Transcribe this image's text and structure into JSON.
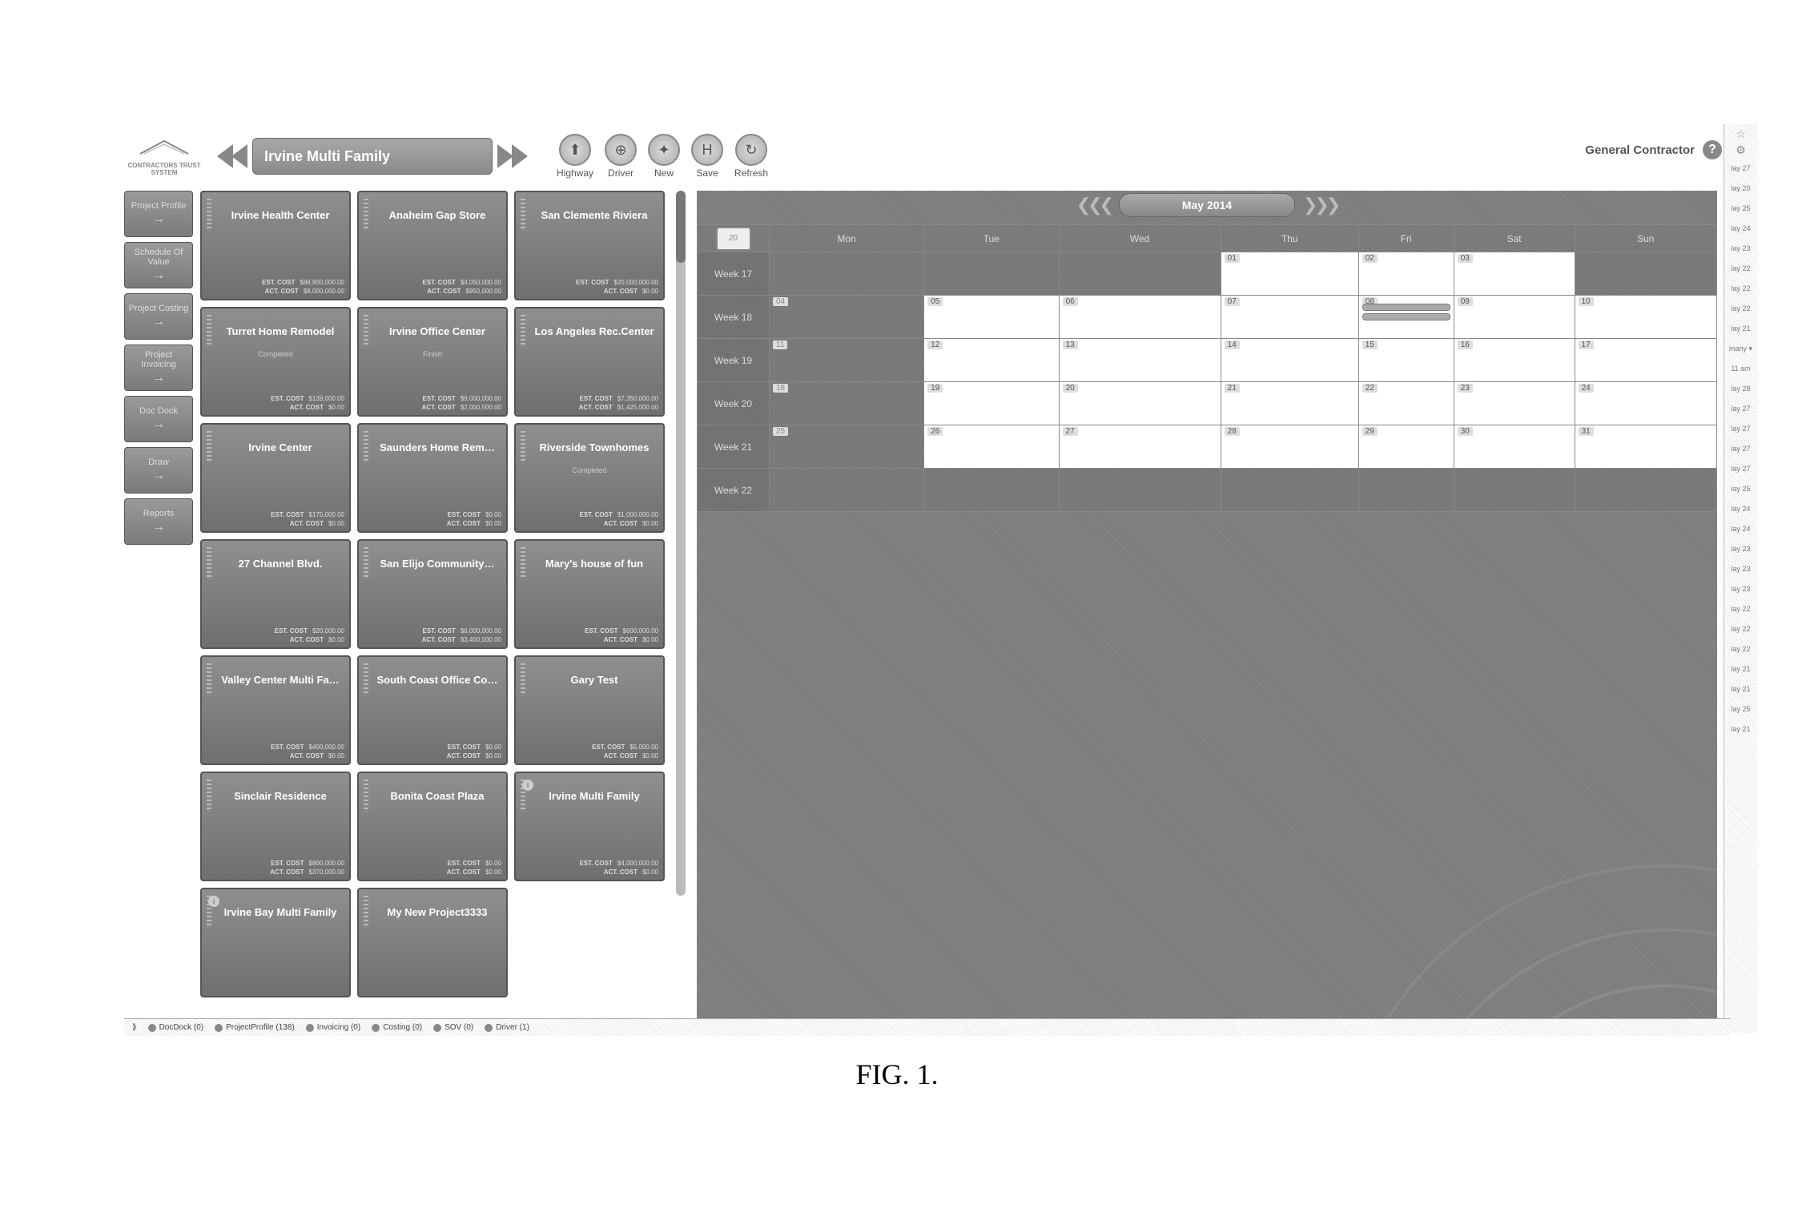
{
  "header": {
    "logo_text": "CONTRACTORS TRUST SYSTEM",
    "project_title": "Irvine Multi Family",
    "user_role": "General Contractor",
    "actions": [
      {
        "id": "highway",
        "label": "Highway",
        "glyph": "⬆"
      },
      {
        "id": "driver",
        "label": "Driver",
        "glyph": "⊕"
      },
      {
        "id": "new",
        "label": "New",
        "glyph": "✦"
      },
      {
        "id": "save",
        "label": "Save",
        "glyph": "H"
      },
      {
        "id": "refresh",
        "label": "Refresh",
        "glyph": "↻"
      }
    ]
  },
  "sidebar": [
    {
      "id": "project-profile",
      "label": "Project Profile"
    },
    {
      "id": "schedule-of-value",
      "label": "Schedule Of Value"
    },
    {
      "id": "project-costing",
      "label": "Project Costing"
    },
    {
      "id": "project-invoicing",
      "label": "Project Invoicing"
    },
    {
      "id": "doc-dock",
      "label": "Doc Dock"
    },
    {
      "id": "draw",
      "label": "Draw"
    },
    {
      "id": "reports",
      "label": "Reports"
    }
  ],
  "projects": [
    {
      "title": "Irvine Health Center",
      "status": "",
      "est": "$88,800,000.00",
      "act": "$8,000,000.00"
    },
    {
      "title": "Anaheim Gap Store",
      "status": "",
      "est": "$4,050,000.00",
      "act": "$950,000.00"
    },
    {
      "title": "San Clemente Riviera",
      "status": "",
      "est": "$20,000,000.00",
      "act": "$0.00"
    },
    {
      "title": "Turret Home Remodel",
      "status": "Completed",
      "est": "$139,000.00",
      "act": "$0.00"
    },
    {
      "title": "Irvine Office Center",
      "status": "Finish",
      "est": "$9,000,000.00",
      "act": "$2,000,000.00"
    },
    {
      "title": "Los Angeles Rec.Center",
      "status": "",
      "est": "$7,350,000.00",
      "act": "$1,425,000.00"
    },
    {
      "title": "Irvine Center",
      "status": "",
      "est": "$175,000.00",
      "act": "$0.00"
    },
    {
      "title": "Saunders Home Rem…",
      "status": "",
      "est": "$0.00",
      "act": "$0.00"
    },
    {
      "title": "Riverside Townhomes",
      "status": "Completed",
      "est": "$1,000,000.00",
      "act": "$0.00"
    },
    {
      "title": "27 Channel Blvd.",
      "status": "",
      "est": "$20,000.00",
      "act": "$0.00"
    },
    {
      "title": "San Elijo Community…",
      "status": "",
      "est": "$6,000,000.00",
      "act": "$3,400,000.00"
    },
    {
      "title": "Mary's house of fun",
      "status": "",
      "est": "$600,000.00",
      "act": "$0.00"
    },
    {
      "title": "Valley Center Multi Fa…",
      "status": "",
      "est": "$400,000.00",
      "act": "$0.00"
    },
    {
      "title": "South Coast Office Co…",
      "status": "",
      "est": "$0.00",
      "act": "$0.00"
    },
    {
      "title": "Gary Test",
      "status": "",
      "est": "$5,000.00",
      "act": "$0.00"
    },
    {
      "title": "Sinclair Residence",
      "status": "",
      "est": "$800,000.00",
      "act": "$370,000.00"
    },
    {
      "title": "Bonita Coast Plaza",
      "status": "",
      "est": "$0.00",
      "act": "$0.00"
    },
    {
      "title": "Irvine Multi Family",
      "status": "",
      "est": "$4,000,000.00",
      "act": "$0.00",
      "badge": true
    },
    {
      "title": "Irvine Bay Multi Family",
      "status": "",
      "est": "",
      "act": "",
      "badge": true
    },
    {
      "title": "My New Project3333",
      "status": "",
      "est": "",
      "act": ""
    }
  ],
  "labels": {
    "est": "EST. COST",
    "act": "ACT. COST"
  },
  "calendar": {
    "month": "May 2014",
    "pick_label": "20",
    "days": [
      "Mon",
      "Tue",
      "Wed",
      "Thu",
      "Fri",
      "Sat",
      "Sun"
    ],
    "weeks": [
      {
        "label": "Week 17",
        "cells": [
          {
            "n": "",
            "gray": true
          },
          {
            "n": "",
            "gray": true
          },
          {
            "n": "",
            "gray": true
          },
          {
            "n": "01"
          },
          {
            "n": "02"
          },
          {
            "n": "03"
          },
          {
            "n": "",
            "gray": true
          }
        ]
      },
      {
        "label": "Week 18",
        "cells": [
          {
            "n": "04",
            "gray": true
          },
          {
            "n": "05"
          },
          {
            "n": "06"
          },
          {
            "n": "07"
          },
          {
            "n": "08",
            "events": 2
          },
          {
            "n": "09"
          },
          {
            "n": "10"
          }
        ]
      },
      {
        "label": "Week 19",
        "cells": [
          {
            "n": "11",
            "gray": true
          },
          {
            "n": "12"
          },
          {
            "n": "13"
          },
          {
            "n": "14"
          },
          {
            "n": "15"
          },
          {
            "n": "16"
          },
          {
            "n": "17"
          }
        ]
      },
      {
        "label": "Week 20",
        "cells": [
          {
            "n": "18",
            "gray": true
          },
          {
            "n": "19"
          },
          {
            "n": "20"
          },
          {
            "n": "21"
          },
          {
            "n": "22"
          },
          {
            "n": "23"
          },
          {
            "n": "24"
          }
        ]
      },
      {
        "label": "Week 21",
        "cells": [
          {
            "n": "25",
            "gray": true
          },
          {
            "n": "26"
          },
          {
            "n": "27"
          },
          {
            "n": "28"
          },
          {
            "n": "29"
          },
          {
            "n": "30"
          },
          {
            "n": "31"
          }
        ]
      },
      {
        "label": "Week 22",
        "cells": [
          {
            "n": "",
            "gray": true
          },
          {
            "n": "",
            "gray": true
          },
          {
            "n": "",
            "gray": true
          },
          {
            "n": "",
            "gray": true
          },
          {
            "n": "",
            "gray": true
          },
          {
            "n": "",
            "gray": true
          },
          {
            "n": "",
            "gray": true
          }
        ]
      }
    ]
  },
  "statusbar": [
    {
      "label": "DocDock (0)"
    },
    {
      "label": "ProjectProfile (138)"
    },
    {
      "label": "Invoicing (0)"
    },
    {
      "label": "Costing (0)"
    },
    {
      "label": "SOV (0)"
    },
    {
      "label": "Driver (1)"
    }
  ],
  "right_strip": {
    "dropdown": "many",
    "time": "11 am",
    "items": [
      "lay 27",
      "lay 20",
      "lay 25",
      "lay 24",
      "lay 23",
      "lay 22",
      "lay 22",
      "lay 22",
      "lay 21",
      "",
      "",
      "lay 28",
      "lay 27",
      "lay 27",
      "lay 27",
      "lay 27",
      "lay 25",
      "lay 24",
      "lay 24",
      "lay 23",
      "lay 23",
      "lay 23",
      "lay 22",
      "lay 22",
      "lay 22",
      "lay 21",
      "lay 21",
      "lay 25",
      "lay 21"
    ]
  },
  "figure_label": "FIG. 1."
}
